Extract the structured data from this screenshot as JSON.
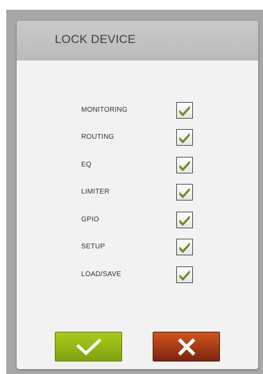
{
  "dialog": {
    "title": "LOCK DEVICE",
    "options": [
      {
        "label": "MONITORING",
        "checked": true
      },
      {
        "label": "ROUTING",
        "checked": true
      },
      {
        "label": "EQ",
        "checked": true
      },
      {
        "label": "LIMITER",
        "checked": true
      },
      {
        "label": "GPIO",
        "checked": true
      },
      {
        "label": "SETUP",
        "checked": true
      },
      {
        "label": "LOAD/SAVE",
        "checked": true
      }
    ],
    "confirm_icon": "checkmark-icon",
    "cancel_icon": "close-icon"
  },
  "colors": {
    "check_green": "#7aa51b",
    "confirm_green": "#9ac016",
    "cancel_red": "#b2401a",
    "header_gray": "#c4c4c4"
  }
}
